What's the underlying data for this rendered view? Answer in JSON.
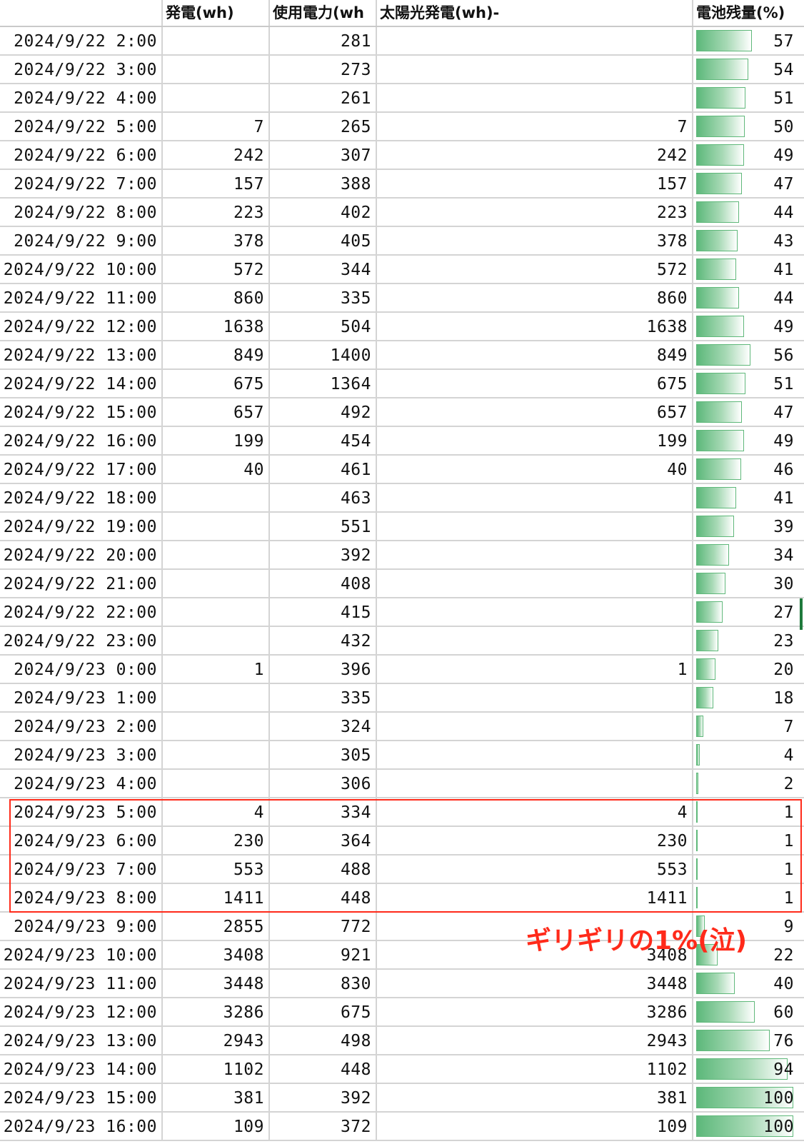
{
  "headers": {
    "date": "",
    "gen": "発電(wh)",
    "use": "使用電力(wh",
    "solar": "太陽光発電(wh)-",
    "battery": "電池残量(%)"
  },
  "annotation": "ギリギリの1%(泣)",
  "colors": {
    "bar": "#5cb87a",
    "highlight": "#ff2a1a"
  },
  "rows": [
    {
      "date": "2024/9/22 2:00",
      "gen": "",
      "use": "281",
      "solar": "",
      "battery": "57",
      "battery_pct": 57
    },
    {
      "date": "2024/9/22 3:00",
      "gen": "",
      "use": "273",
      "solar": "",
      "battery": "54",
      "battery_pct": 54
    },
    {
      "date": "2024/9/22 4:00",
      "gen": "",
      "use": "261",
      "solar": "",
      "battery": "51",
      "battery_pct": 51
    },
    {
      "date": "2024/9/22 5:00",
      "gen": "7",
      "use": "265",
      "solar": "7",
      "battery": "50",
      "battery_pct": 50
    },
    {
      "date": "2024/9/22 6:00",
      "gen": "242",
      "use": "307",
      "solar": "242",
      "battery": "49",
      "battery_pct": 49
    },
    {
      "date": "2024/9/22 7:00",
      "gen": "157",
      "use": "388",
      "solar": "157",
      "battery": "47",
      "battery_pct": 47
    },
    {
      "date": "2024/9/22 8:00",
      "gen": "223",
      "use": "402",
      "solar": "223",
      "battery": "44",
      "battery_pct": 44
    },
    {
      "date": "2024/9/22 9:00",
      "gen": "378",
      "use": "405",
      "solar": "378",
      "battery": "43",
      "battery_pct": 43
    },
    {
      "date": "2024/9/22 10:00",
      "gen": "572",
      "use": "344",
      "solar": "572",
      "battery": "41",
      "battery_pct": 41
    },
    {
      "date": "2024/9/22 11:00",
      "gen": "860",
      "use": "335",
      "solar": "860",
      "battery": "44",
      "battery_pct": 44
    },
    {
      "date": "2024/9/22 12:00",
      "gen": "1638",
      "use": "504",
      "solar": "1638",
      "battery": "49",
      "battery_pct": 49
    },
    {
      "date": "2024/9/22 13:00",
      "gen": "849",
      "use": "1400",
      "solar": "849",
      "battery": "56",
      "battery_pct": 56
    },
    {
      "date": "2024/9/22 14:00",
      "gen": "675",
      "use": "1364",
      "solar": "675",
      "battery": "51",
      "battery_pct": 51
    },
    {
      "date": "2024/9/22 15:00",
      "gen": "657",
      "use": "492",
      "solar": "657",
      "battery": "47",
      "battery_pct": 47
    },
    {
      "date": "2024/9/22 16:00",
      "gen": "199",
      "use": "454",
      "solar": "199",
      "battery": "49",
      "battery_pct": 49
    },
    {
      "date": "2024/9/22 17:00",
      "gen": "40",
      "use": "461",
      "solar": "40",
      "battery": "46",
      "battery_pct": 46
    },
    {
      "date": "2024/9/22 18:00",
      "gen": "",
      "use": "463",
      "solar": "",
      "battery": "41",
      "battery_pct": 41
    },
    {
      "date": "2024/9/22 19:00",
      "gen": "",
      "use": "551",
      "solar": "",
      "battery": "39",
      "battery_pct": 39
    },
    {
      "date": "2024/9/22 20:00",
      "gen": "",
      "use": "392",
      "solar": "",
      "battery": "34",
      "battery_pct": 34
    },
    {
      "date": "2024/9/22 21:00",
      "gen": "",
      "use": "408",
      "solar": "",
      "battery": "30",
      "battery_pct": 30
    },
    {
      "date": "2024/9/22 22:00",
      "gen": "",
      "use": "415",
      "solar": "",
      "battery": "27",
      "battery_pct": 27
    },
    {
      "date": "2024/9/22 23:00",
      "gen": "",
      "use": "432",
      "solar": "",
      "battery": "23",
      "battery_pct": 23
    },
    {
      "date": "2024/9/23 0:00",
      "gen": "1",
      "use": "396",
      "solar": "1",
      "battery": "20",
      "battery_pct": 20
    },
    {
      "date": "2024/9/23 1:00",
      "gen": "",
      "use": "335",
      "solar": "",
      "battery": "18",
      "battery_pct": 18
    },
    {
      "date": "2024/9/23 2:00",
      "gen": "",
      "use": "324",
      "solar": "",
      "battery": "7",
      "battery_pct": 7
    },
    {
      "date": "2024/9/23 3:00",
      "gen": "",
      "use": "305",
      "solar": "",
      "battery": "4",
      "battery_pct": 4
    },
    {
      "date": "2024/9/23 4:00",
      "gen": "",
      "use": "306",
      "solar": "",
      "battery": "2",
      "battery_pct": 2
    },
    {
      "date": "2024/9/23 5:00",
      "gen": "4",
      "use": "334",
      "solar": "4",
      "battery": "1",
      "battery_pct": 1
    },
    {
      "date": "2024/9/23 6:00",
      "gen": "230",
      "use": "364",
      "solar": "230",
      "battery": "1",
      "battery_pct": 1
    },
    {
      "date": "2024/9/23 7:00",
      "gen": "553",
      "use": "488",
      "solar": "553",
      "battery": "1",
      "battery_pct": 1
    },
    {
      "date": "2024/9/23 8:00",
      "gen": "1411",
      "use": "448",
      "solar": "1411",
      "battery": "1",
      "battery_pct": 1
    },
    {
      "date": "2024/9/23 9:00",
      "gen": "2855",
      "use": "772",
      "solar": "",
      "battery": "9",
      "battery_pct": 9
    },
    {
      "date": "2024/9/23 10:00",
      "gen": "3408",
      "use": "921",
      "solar": "3408",
      "battery": "22",
      "battery_pct": 22
    },
    {
      "date": "2024/9/23 11:00",
      "gen": "3448",
      "use": "830",
      "solar": "3448",
      "battery": "40",
      "battery_pct": 40
    },
    {
      "date": "2024/9/23 12:00",
      "gen": "3286",
      "use": "675",
      "solar": "3286",
      "battery": "60",
      "battery_pct": 60
    },
    {
      "date": "2024/9/23 13:00",
      "gen": "2943",
      "use": "498",
      "solar": "2943",
      "battery": "76",
      "battery_pct": 76
    },
    {
      "date": "2024/9/23 14:00",
      "gen": "1102",
      "use": "448",
      "solar": "1102",
      "battery": "94",
      "battery_pct": 94
    },
    {
      "date": "2024/9/23 15:00",
      "gen": "381",
      "use": "392",
      "solar": "381",
      "battery": "100",
      "battery_pct": 100
    },
    {
      "date": "2024/9/23 16:00",
      "gen": "109",
      "use": "372",
      "solar": "109",
      "battery": "100",
      "battery_pct": 100
    }
  ]
}
